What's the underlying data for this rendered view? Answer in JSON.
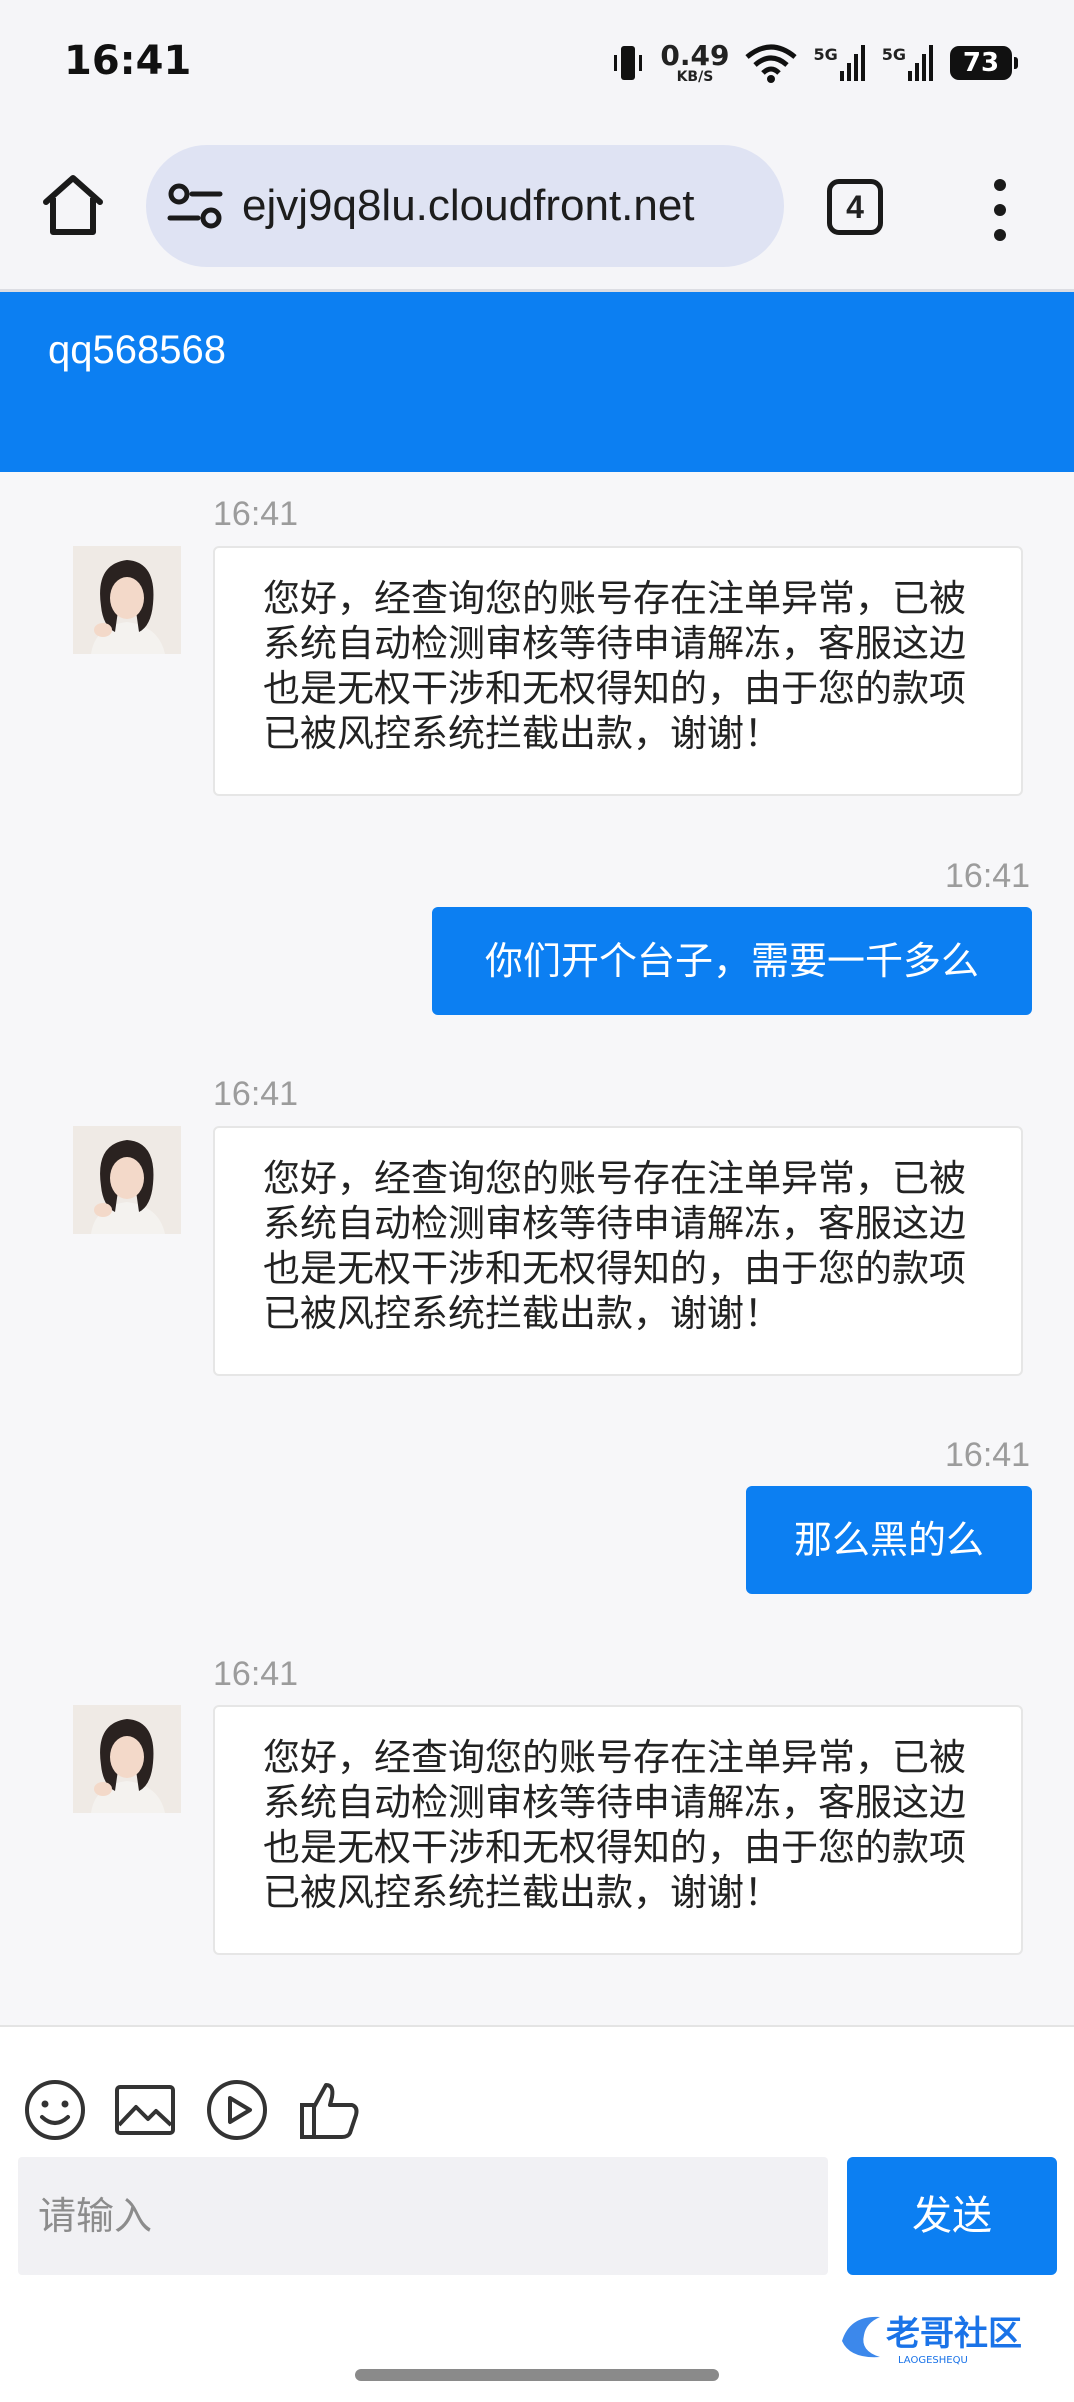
{
  "status_bar": {
    "time": "16:41",
    "net_speed": "0.49",
    "net_unit": "KB/S",
    "signal1_label": "5G",
    "signal2_label": "5G",
    "battery": "73"
  },
  "browser": {
    "url": "ejvj9q8lu.cloudfront.net",
    "tab_count": "4"
  },
  "chat": {
    "title": "qq568568",
    "messages": [
      {
        "time": "16:41",
        "direction": "incoming",
        "text": "您好，经查询您的账号存在注单异常，已被系统自动检测审核等待申请解冻，客服这边也是无权干涉和无权得知的，由于您的款项已被风控系统拦截出款，谢谢！"
      },
      {
        "time": "16:41",
        "direction": "outgoing",
        "text": "你们开个台子，需要一千多么"
      },
      {
        "time": "16:41",
        "direction": "incoming",
        "text": "您好，经查询您的账号存在注单异常，已被系统自动检测审核等待申请解冻，客服这边也是无权干涉和无权得知的，由于您的款项已被风控系统拦截出款，谢谢！"
      },
      {
        "time": "16:41",
        "direction": "outgoing",
        "text": "那么黑的么"
      },
      {
        "time": "16:41",
        "direction": "incoming",
        "text": "您好，经查询您的账号存在注单异常，已被系统自动检测审核等待申请解冻，客服这边也是无权干涉和无权得知的，由于您的款项已被风控系统拦截出款，谢谢！"
      }
    ]
  },
  "composer": {
    "placeholder": "请输入",
    "send_label": "发送",
    "tools": [
      "emoji-icon",
      "image-icon",
      "video-icon",
      "thumbs-up-icon"
    ]
  },
  "watermark": {
    "text": "老哥社区",
    "subtext": "LAOGESHEQU"
  },
  "colors": {
    "accent": "#0c7ff2",
    "background": "#f7f7f9",
    "url_pill": "#dfe3f3"
  }
}
